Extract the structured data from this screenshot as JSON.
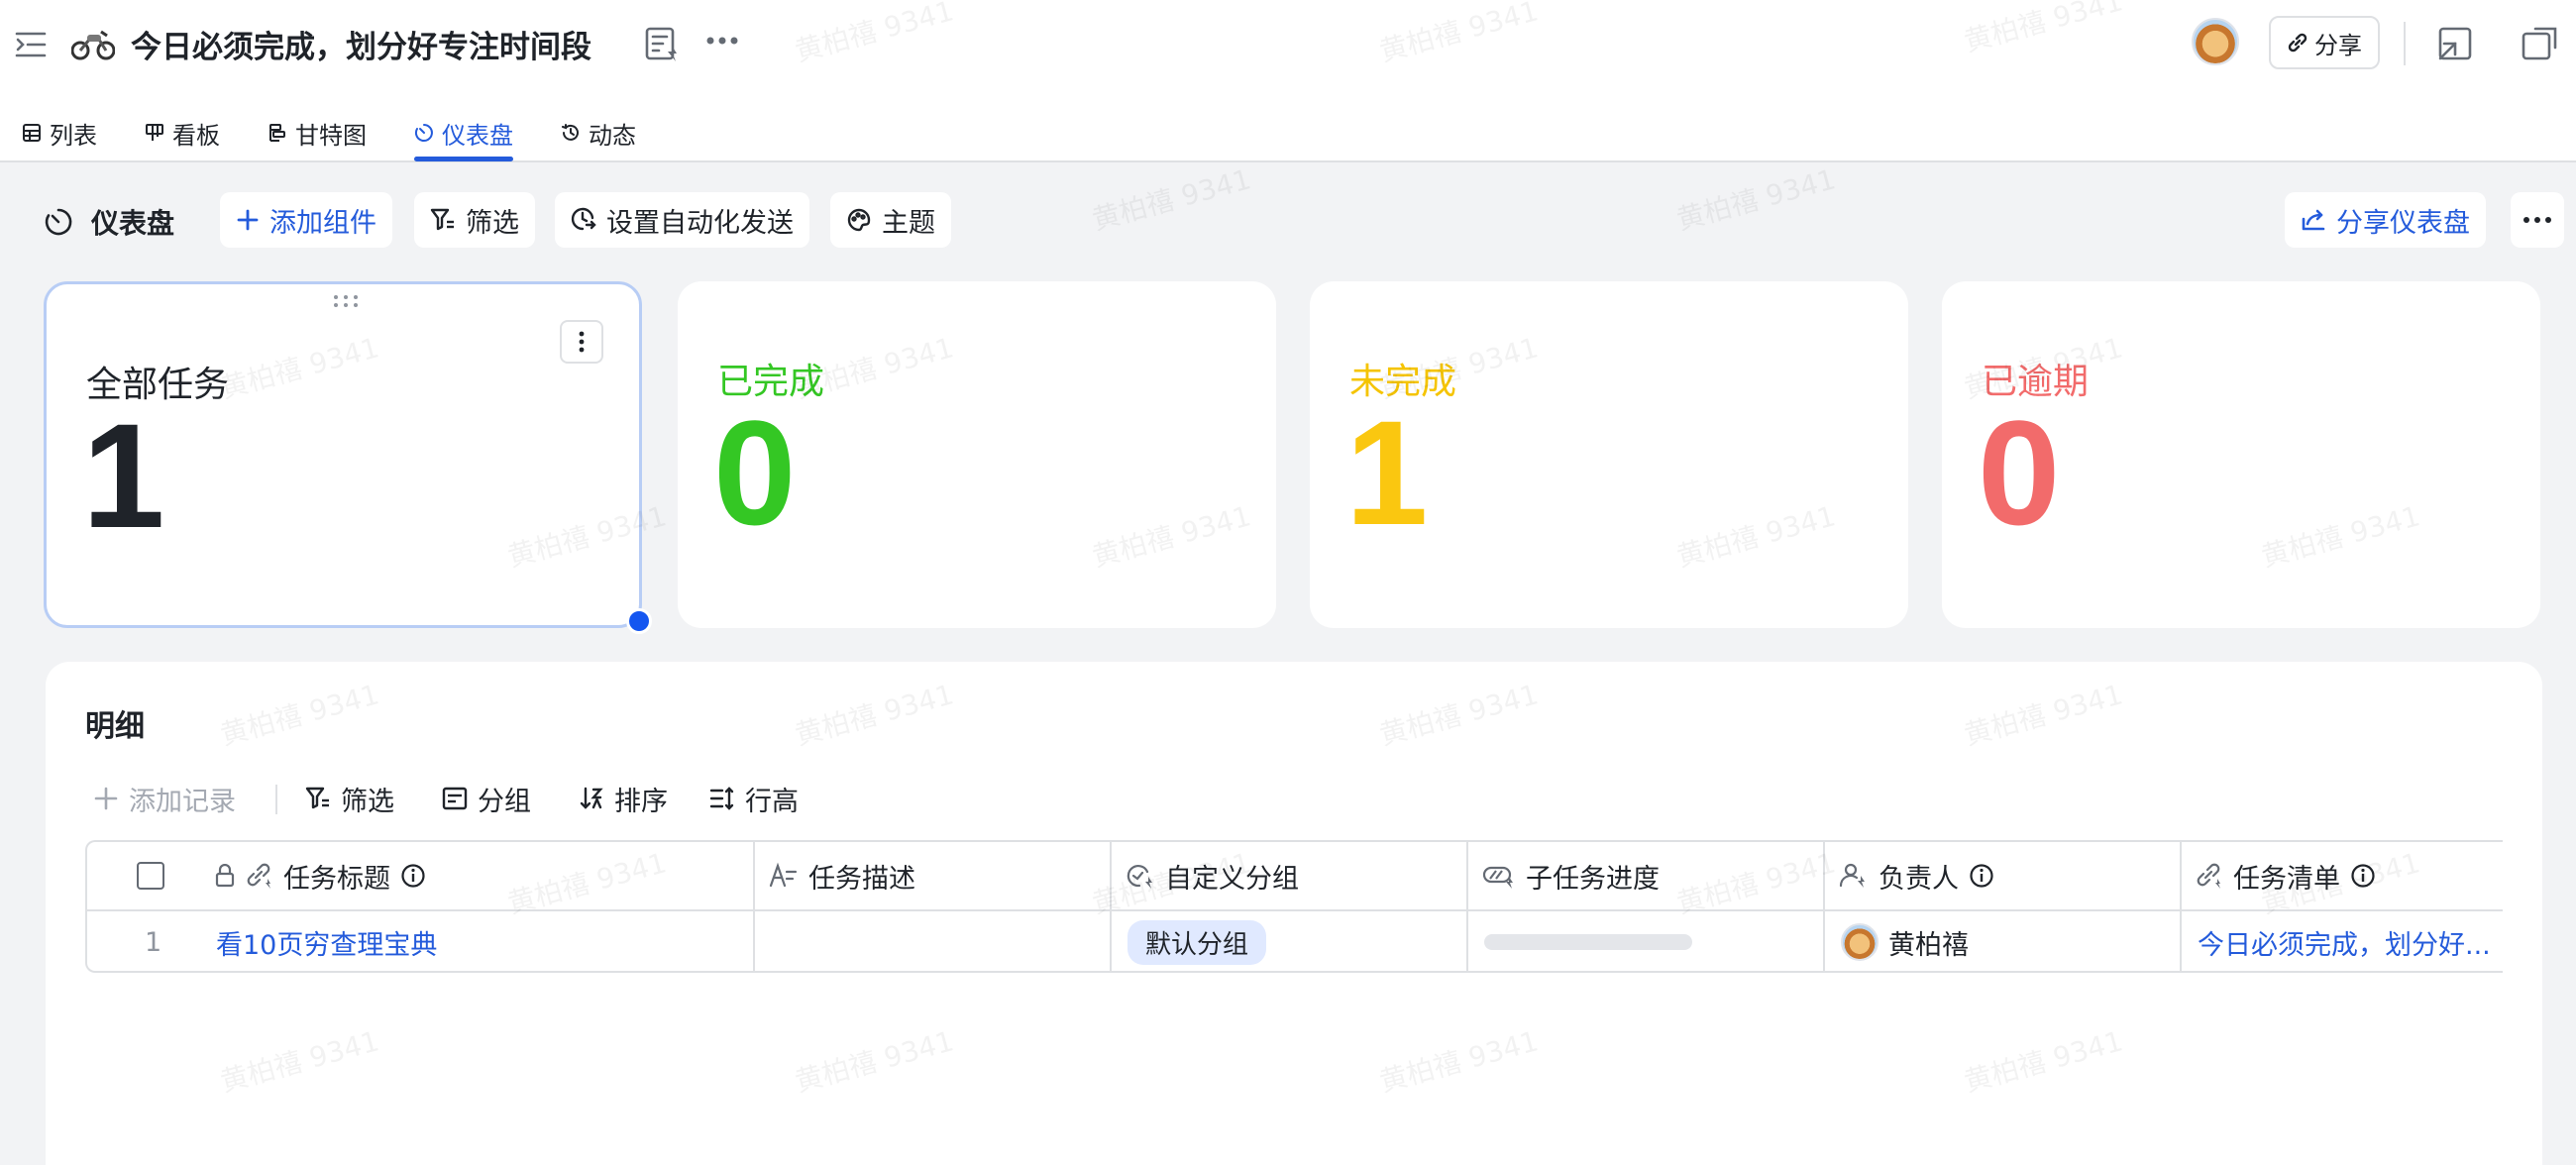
{
  "header": {
    "title": "今日必须完成，划分好专注时间段",
    "share_label": "分享"
  },
  "tabs": [
    {
      "label": "列表",
      "icon": "table-icon"
    },
    {
      "label": "看板",
      "icon": "kanban-icon"
    },
    {
      "label": "甘特图",
      "icon": "gantt-icon"
    },
    {
      "label": "仪表盘",
      "icon": "dashboard-icon",
      "active": true
    },
    {
      "label": "动态",
      "icon": "history-icon"
    }
  ],
  "dashboard": {
    "title": "仪表盘",
    "add_widget": "添加组件",
    "filter": "筛选",
    "auto_send": "设置自动化发送",
    "theme": "主题",
    "share_dashboard": "分享仪表盘"
  },
  "cards": [
    {
      "label": "全部任务",
      "value": "1",
      "color": "#1f2329",
      "label_color": "#1f2329"
    },
    {
      "label": "已完成",
      "value": "0",
      "color": "#34c724",
      "label_color": "#34c724"
    },
    {
      "label": "未完成",
      "value": "1",
      "color": "#fac710",
      "label_color": "#f5c400"
    },
    {
      "label": "已逾期",
      "value": "0",
      "color": "#f26b6b",
      "label_color": "#f26b6b"
    }
  ],
  "detail": {
    "title": "明细",
    "tools": {
      "add_record": "添加记录",
      "filter": "筛选",
      "group": "分组",
      "sort": "排序",
      "row_height": "行高"
    },
    "columns": [
      "任务标题",
      "任务描述",
      "自定义分组",
      "子任务进度",
      "负责人",
      "任务清单"
    ],
    "rows": [
      {
        "index": "1",
        "title": "看10页穷查理宝典",
        "description": "",
        "group": "默认分组",
        "subtask_progress": 0,
        "assignee": "黄柏禧",
        "tasklist": "今日必须完成，划分好..."
      }
    ]
  },
  "watermark": "黄柏禧 9341",
  "colors": {
    "accent": "#245bdb",
    "selection_border": "#b8cdf5",
    "background": "#f2f3f5"
  }
}
